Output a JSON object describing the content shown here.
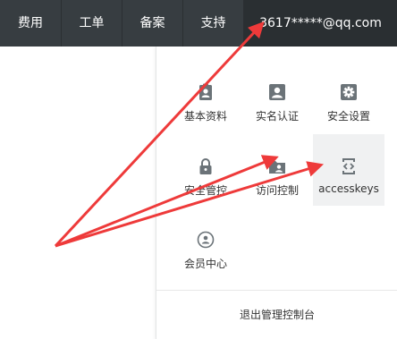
{
  "topbar": {
    "items": [
      {
        "label": "费用"
      },
      {
        "label": "工单"
      },
      {
        "label": "备案"
      },
      {
        "label": "支持"
      }
    ],
    "account": "3617*****@qq.com"
  },
  "dropdown": {
    "tiles": [
      {
        "label": "基本资料",
        "icon": "profile-card-icon"
      },
      {
        "label": "实名认证",
        "icon": "id-person-icon"
      },
      {
        "label": "安全设置",
        "icon": "gear-icon"
      },
      {
        "label": "安全管控",
        "icon": "lock-icon"
      },
      {
        "label": "访问控制",
        "icon": "folder-user-icon"
      },
      {
        "label": "accesskeys",
        "icon": "code-key-icon"
      },
      {
        "label": "会员中心",
        "icon": "member-circle-icon"
      }
    ],
    "logout": "退出管理控制台"
  },
  "colors": {
    "topbar": "#373d41",
    "account_bg": "#2a2f32",
    "icon": "#6b7378",
    "arrow": "#ee3a3a",
    "active_tile": "#f0f1f2"
  }
}
